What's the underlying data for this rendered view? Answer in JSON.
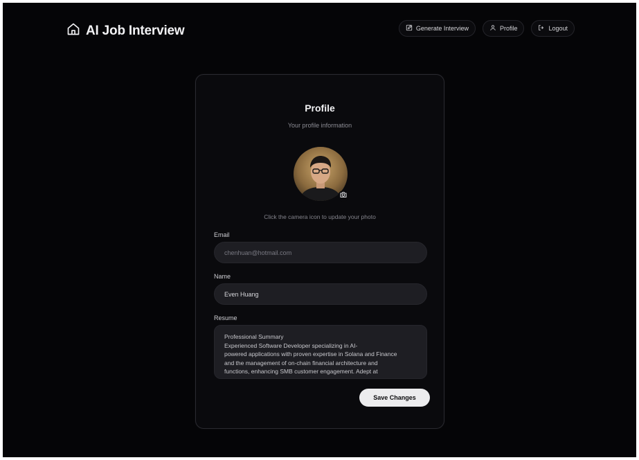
{
  "header": {
    "brand_title": "AI Job Interview",
    "nav": {
      "generate_label": "Generate Interview",
      "profile_label": "Profile",
      "logout_label": "Logout"
    }
  },
  "profile": {
    "title": "Profile",
    "subtitle": "Your profile information",
    "avatar_hint": "Click the camera icon to update your photo",
    "email": {
      "label": "Email",
      "value": "chenhuan@hotmail.com"
    },
    "name": {
      "label": "Name",
      "value": "Even Huang"
    },
    "resume": {
      "label": "Resume",
      "value": "Professional Summary\nExperienced Software Developer specializing in AI-\npowered applications with proven expertise in Solana and Finance\nand the management of on-chain financial architecture and\nfunctions, enhancing SMB customer engagement. Adept at"
    },
    "save_label": "Save Changes"
  },
  "icons": {
    "brand": "home-icon",
    "generate": "edit-icon",
    "profile": "user-icon",
    "logout": "logout-icon",
    "camera": "camera-icon"
  },
  "colors": {
    "background": "#050507",
    "card": "#0a0a0d",
    "field": "#1e1e23",
    "button": "#ececee",
    "text": "#f1f1f3"
  }
}
